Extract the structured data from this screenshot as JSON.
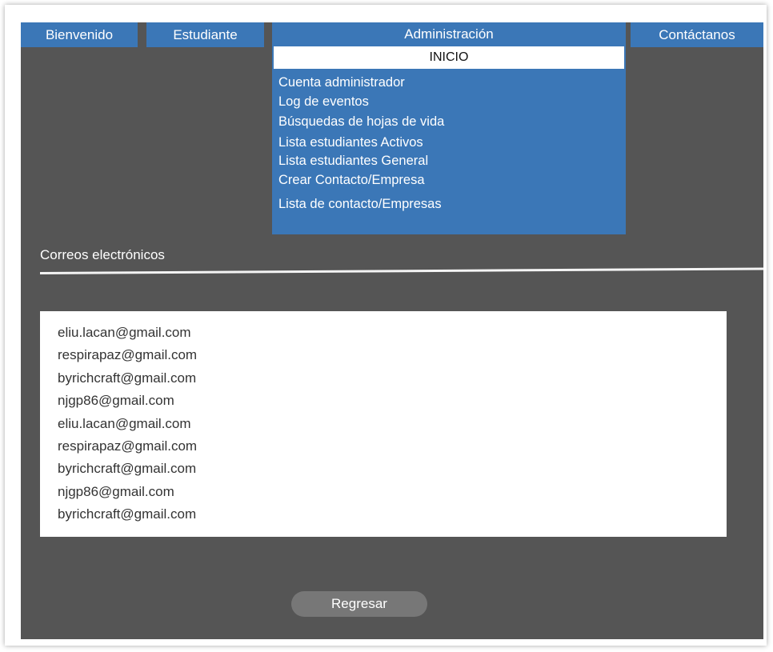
{
  "nav": {
    "bienvenido": "Bienvenido",
    "estudiante": "Estudiante",
    "administracion": "Administración",
    "contactanos": "Contáctanos"
  },
  "admin_menu": {
    "inicio": "INICIO",
    "items": [
      "Cuenta administrador",
      "Log de eventos",
      "Búsquedas de hojas de vida",
      "Lista estudiantes Activos",
      "Lista estudiantes General",
      "Crear Contacto/Empresa",
      "Lista de contacto/Empresas"
    ]
  },
  "section": {
    "title": "Correos electrónicos"
  },
  "emails": [
    "eliu.lacan@gmail.com",
    "respirapaz@gmail.com",
    "byrichcraft@gmail.com",
    "njgp86@gmail.com",
    "eliu.lacan@gmail.com",
    "respirapaz@gmail.com",
    "byrichcraft@gmail.com",
    "njgp86@gmail.com",
    "byrichcraft@gmail.com"
  ],
  "actions": {
    "back_label": "Regresar"
  },
  "colors": {
    "panel": "#555555",
    "accent_blue": "#3b77b7",
    "button_gray": "#777777"
  }
}
